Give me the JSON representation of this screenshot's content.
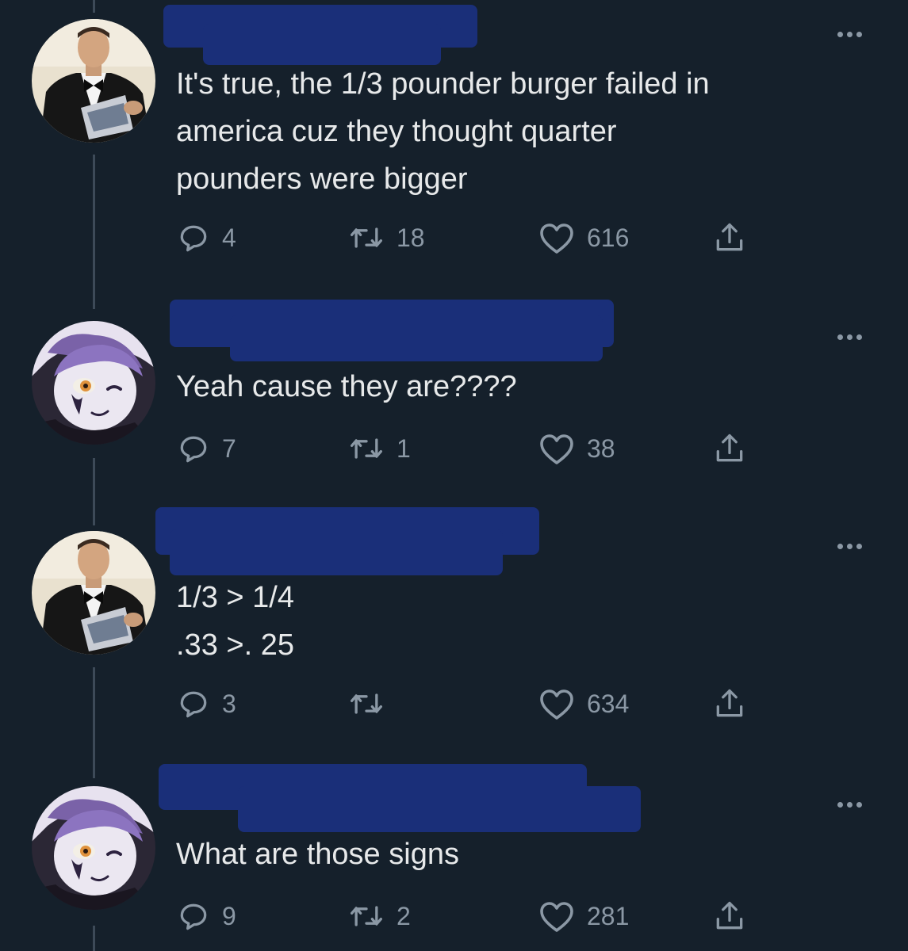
{
  "tweets": [
    {
      "avatar": "tuxedo-man-avatar",
      "text": "It's true, the 1/3 pounder burger failed in\namerica cuz they thought quarter\npounders were bigger",
      "replies": "4",
      "retweets": "18",
      "likes": "616"
    },
    {
      "avatar": "anime-avatar",
      "text": "Yeah cause they are????",
      "replies": "7",
      "retweets": "1",
      "likes": "38"
    },
    {
      "avatar": "tuxedo-man-avatar",
      "text": "1/3 > 1/4\n.33 >. 25",
      "replies": "3",
      "retweets": "",
      "likes": "634"
    },
    {
      "avatar": "anime-avatar",
      "text": "What are those signs",
      "replies": "9",
      "retweets": "2",
      "likes": "281"
    }
  ],
  "icons": {
    "reply": "reply-icon",
    "retweet": "retweet-icon",
    "like": "heart-icon",
    "share": "share-icon",
    "more": "more-options-icon"
  },
  "colors": {
    "background": "#15202b",
    "text": "#e7e9ea",
    "muted": "#8b98a5",
    "redaction": "#1a2f79",
    "thread_line": "#3d4a58"
  }
}
